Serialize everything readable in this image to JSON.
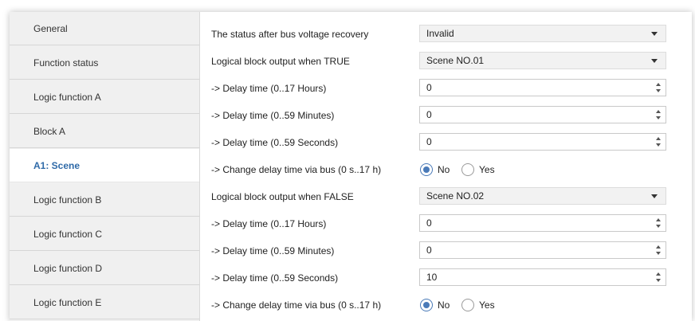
{
  "sidebar": {
    "items": [
      {
        "label": "General"
      },
      {
        "label": "Function status"
      },
      {
        "label": "Logic function A"
      },
      {
        "label": "Block A"
      },
      {
        "label": "A1: Scene"
      },
      {
        "label": "Logic function B"
      },
      {
        "label": "Logic function C"
      },
      {
        "label": "Logic function D"
      },
      {
        "label": "Logic function E"
      }
    ]
  },
  "params": {
    "status_recovery": {
      "label": "The status after bus voltage recovery",
      "value": "Invalid"
    },
    "true_output": {
      "label": "Logical block output when TRUE",
      "value": "Scene NO.01"
    },
    "true_hours": {
      "label": "-> Delay time (0..17 Hours)",
      "value": "0"
    },
    "true_minutes": {
      "label": "-> Delay time (0..59 Minutes)",
      "value": "0"
    },
    "true_seconds": {
      "label": "-> Delay time (0..59 Seconds)",
      "value": "0"
    },
    "true_change_delay": {
      "label": "-> Change delay time via bus (0 s..17 h)",
      "no": "No",
      "yes": "Yes",
      "selected": "No"
    },
    "false_output": {
      "label": "Logical block output when FALSE",
      "value": "Scene NO.02"
    },
    "false_hours": {
      "label": "-> Delay time (0..17 Hours)",
      "value": "0"
    },
    "false_minutes": {
      "label": "-> Delay time (0..59 Minutes)",
      "value": "0"
    },
    "false_seconds": {
      "label": "-> Delay time (0..59 Seconds)",
      "value": "10"
    },
    "false_change_delay": {
      "label": "-> Change delay time via bus (0 s..17 h)",
      "no": "No",
      "yes": "Yes",
      "selected": "No"
    }
  },
  "colors": {
    "accent": "#2f6aa8",
    "radio": "#4a7ab8"
  }
}
